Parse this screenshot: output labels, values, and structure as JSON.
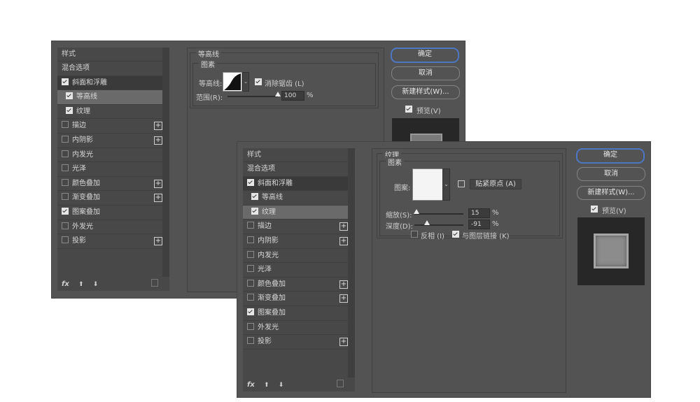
{
  "style_list": {
    "header": "样式",
    "blend_options": "混合选项",
    "items": [
      {
        "label": "斜面和浮雕",
        "checked": true
      },
      {
        "label": "等高线",
        "checked": true
      },
      {
        "label": "纹理",
        "checked": true
      },
      {
        "label": "描边",
        "checked": false,
        "plus": true
      },
      {
        "label": "内阴影",
        "checked": false,
        "plus": true
      },
      {
        "label": "内发光",
        "checked": false
      },
      {
        "label": "光泽",
        "checked": false
      },
      {
        "label": "颜色叠加",
        "checked": false,
        "plus": true
      },
      {
        "label": "渐变叠加",
        "checked": false,
        "plus": true
      },
      {
        "label": "图案叠加",
        "checked": true
      },
      {
        "label": "外发光",
        "checked": false
      },
      {
        "label": "投影",
        "checked": false,
        "plus": true
      }
    ],
    "fx": "fx"
  },
  "contour_panel": {
    "title": "等高线",
    "group": "图素",
    "contour_label": "等高线:",
    "antialias_label": "消除锯齿 (L)",
    "range_label": "范围(R):",
    "range_value": "100",
    "range_unit": "%",
    "range_fraction": 1.0
  },
  "texture_panel": {
    "title": "纹理",
    "group": "图素",
    "pattern_label": "图案:",
    "snap_button": "贴紧原点 (A)",
    "scale_label": "缩放(S):",
    "scale_value": "15",
    "depth_label": "深度(D):",
    "depth_value": "-91",
    "unit": "%",
    "invert_label": "反相 (I)",
    "link_label": "与图层链接 (K)"
  },
  "buttons": {
    "ok": "确定",
    "cancel": "取消",
    "new_style": "新建样式(W)...",
    "preview": "预览(V)"
  },
  "colors": {
    "accent": "#4d77c2",
    "panel": "#535353"
  }
}
